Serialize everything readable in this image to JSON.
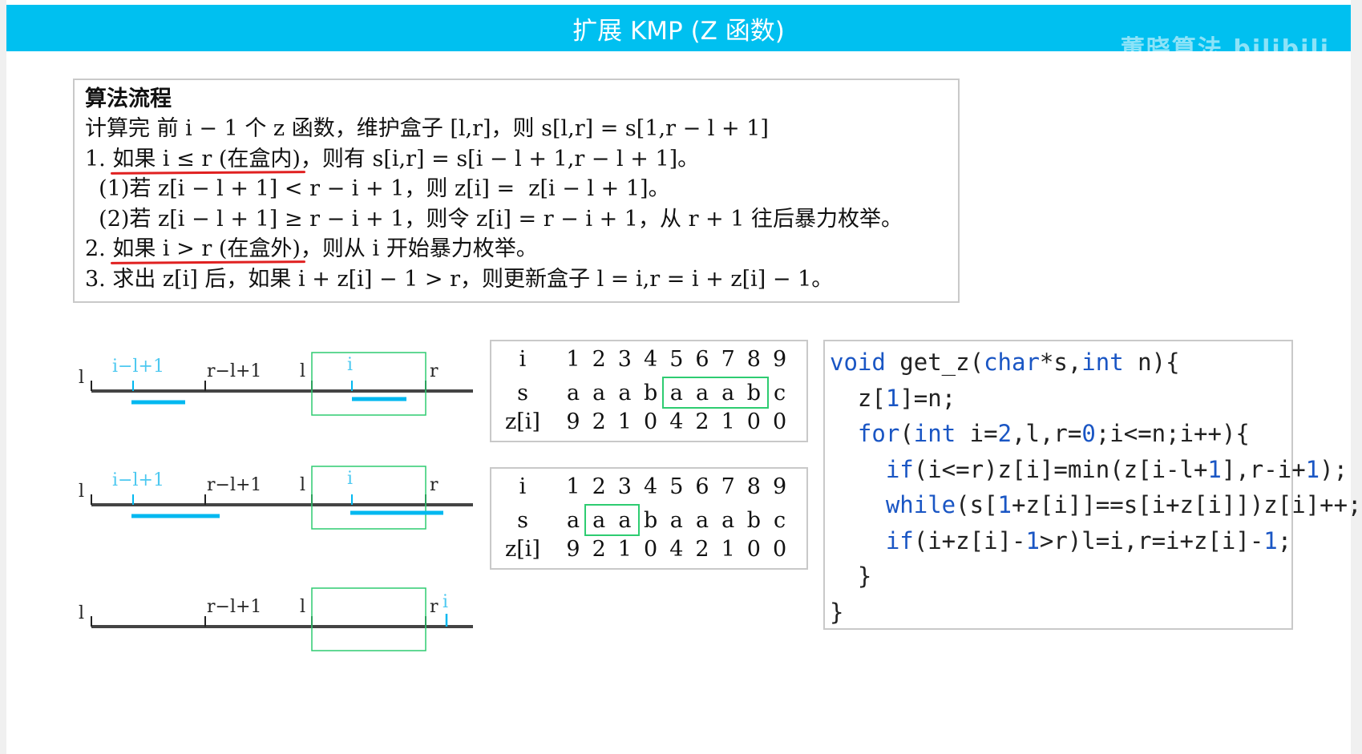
{
  "header": {
    "title": "扩展 KMP (Z 函数)",
    "watermark": "董晓算法 bilibili"
  },
  "algorithm": {
    "title": "算法流程",
    "intro": "计算完 前 i − 1 个 z 函数，维护盒子 [l,r]，则 s[l,r] = s[1,r − l + 1]",
    "step1_prefix": "1. ",
    "step1_cond": "如果 i ≤ r (在盒内)",
    "step1_rest": "，则有 s[i,r] = s[i − l + 1,r − l + 1]。",
    "step1a": "  (1)若 z[i − l + 1] < r − i + 1，则 z[i] =  z[i − l + 1]。",
    "step1b": "  (2)若 z[i − l + 1] ≥ r − i + 1，则令 z[i] = r − i + 1，从 r + 1 往后暴力枚举。",
    "step2_prefix": "2. ",
    "step2_cond": "如果 i > r (在盒外)",
    "step2_rest": "，则从 i 开始暴力枚举。",
    "step3": "3. 求出 z[i] 后，如果 i + z[i] − 1 > r，则更新盒子 l = i,r = i + z[i] − 1。"
  },
  "diagram_labels": {
    "l": "l",
    "i_l_1": "i−l+1",
    "r_l_1": "r−l+1",
    "i": "i",
    "r": "r"
  },
  "tables": [
    {
      "i_label": "i",
      "s_label": "s",
      "z_label": "z[i]",
      "i": [
        "1",
        "2",
        "3",
        "4",
        "5",
        "6",
        "7",
        "8",
        "9"
      ],
      "s": [
        "a",
        "a",
        "a",
        "b",
        "a",
        "a",
        "a",
        "b",
        "c"
      ],
      "z": [
        "9",
        "2",
        "1",
        "0",
        "4",
        "2",
        "1",
        "0",
        "0"
      ],
      "highlight": "positions 5-8"
    },
    {
      "i_label": "i",
      "s_label": "s",
      "z_label": "z[i]",
      "i": [
        "1",
        "2",
        "3",
        "4",
        "5",
        "6",
        "7",
        "8",
        "9"
      ],
      "s": [
        "a",
        "a",
        "a",
        "b",
        "a",
        "a",
        "a",
        "b",
        "c"
      ],
      "z": [
        "9",
        "2",
        "1",
        "0",
        "4",
        "2",
        "1",
        "0",
        "0"
      ],
      "highlight": "positions 2-3"
    }
  ],
  "code": {
    "l1a": "void",
    "l1b": " get_z(",
    "l1c": "char",
    "l1d": "*s,",
    "l1e": "int",
    "l1f": " n){",
    "l2a": "  z[",
    "l2b": "1",
    "l2c": "]=n;",
    "l3a": "  ",
    "l3b": "for",
    "l3c": "(",
    "l3d": "int",
    "l3e": " i=",
    "l3f": "2",
    "l3g": ",l,r=",
    "l3h": "0",
    "l3i": ";i<=n;i++){",
    "l4a": "    ",
    "l4b": "if",
    "l4c": "(i<=r)z[i]=min(z[i-l+",
    "l4d": "1",
    "l4e": "],r-i+",
    "l4f": "1",
    "l4g": ");",
    "l5a": "    ",
    "l5b": "while",
    "l5c": "(s[",
    "l5d": "1",
    "l5e": "+z[i]]==s[i+z[i]])z[i]++;",
    "l6a": "    ",
    "l6b": "if",
    "l6c": "(i+z[i]-",
    "l6d": "1",
    "l6e": ">r)l=i,r=i+z[i]-",
    "l6f": "1",
    "l6g": ";",
    "l7": "  }",
    "l8": "}"
  },
  "colors": {
    "title_bar": "#00c0f0",
    "cyan": "#00b8f0",
    "green_box": "#2ecc71",
    "underline_red": "#e02020",
    "code_keyword": "#1a56c4"
  }
}
